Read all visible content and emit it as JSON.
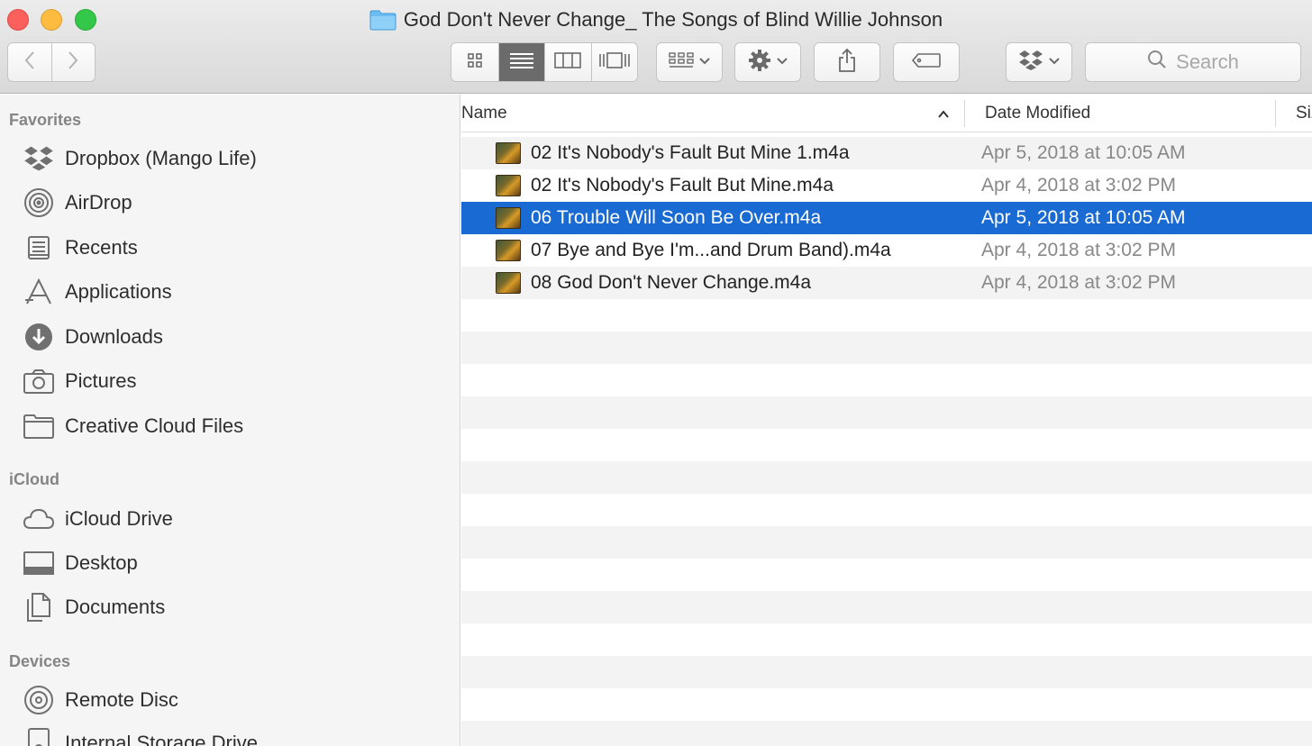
{
  "window": {
    "title": "God Don't Never Change_ The Songs of Blind Willie Johnson"
  },
  "toolbar": {
    "search_placeholder": "Search",
    "active_view": "list"
  },
  "sidebar": {
    "sections": [
      {
        "title": "Favorites",
        "items": [
          {
            "label": "Dropbox (Mango Life)",
            "icon": "dropbox-icon"
          },
          {
            "label": "AirDrop",
            "icon": "airdrop-icon"
          },
          {
            "label": "Recents",
            "icon": "recents-icon"
          },
          {
            "label": "Applications",
            "icon": "applications-icon"
          },
          {
            "label": "Downloads",
            "icon": "downloads-icon"
          },
          {
            "label": "Pictures",
            "icon": "camera-icon"
          },
          {
            "label": "Creative Cloud Files",
            "icon": "folder-icon"
          }
        ]
      },
      {
        "title": "iCloud",
        "items": [
          {
            "label": "iCloud Drive",
            "icon": "cloud-icon"
          },
          {
            "label": "Desktop",
            "icon": "desktop-icon"
          },
          {
            "label": "Documents",
            "icon": "documents-icon"
          }
        ]
      },
      {
        "title": "Devices",
        "items": [
          {
            "label": "Remote Disc",
            "icon": "disc-icon"
          },
          {
            "label": "Internal Storage Drive",
            "icon": "drive-icon"
          }
        ]
      }
    ]
  },
  "list": {
    "columns": {
      "name": "Name",
      "date_modified": "Date Modified",
      "size": "Size"
    },
    "sort": {
      "column": "name",
      "direction": "ascending"
    },
    "files": [
      {
        "name": "02 It's Nobody's Fault But Mine 1.m4a",
        "date": "Apr 5, 2018 at 10:05 AM",
        "selected": false
      },
      {
        "name": "02 It's Nobody's Fault But Mine.m4a",
        "date": "Apr 4, 2018 at 3:02 PM",
        "selected": false
      },
      {
        "name": "06 Trouble Will Soon Be Over.m4a",
        "date": "Apr 5, 2018 at 10:05 AM",
        "selected": true
      },
      {
        "name": "07 Bye and Bye I'm...and Drum Band).m4a",
        "date": "Apr 4, 2018 at 3:02 PM",
        "selected": false
      },
      {
        "name": "08 God Don't Never Change.m4a",
        "date": "Apr 4, 2018 at 3:02 PM",
        "selected": false
      }
    ]
  },
  "colors": {
    "selection": "#1a6ad4",
    "sidebar_bg": "#f5f5f5",
    "folder_accent": "#5fb6ef"
  }
}
